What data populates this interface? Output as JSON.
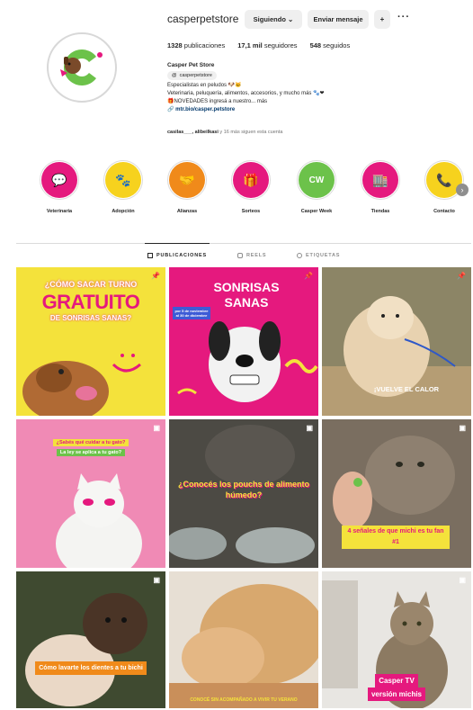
{
  "profile": {
    "username": "casperpetstore",
    "following_button": "Siguiendo",
    "following_chevron": "⌄",
    "message_button": "Enviar mensaje",
    "add_person_glyph": "+",
    "more_glyph": "···",
    "stats": {
      "posts_count": "1328",
      "posts_label": "publicaciones",
      "followers_count": "17,1 mil",
      "followers_label": "seguidores",
      "following_count": "548",
      "following_label": "seguidos"
    },
    "bio": {
      "name": "Casper Pet Store",
      "threads_handle": "casperpetstore",
      "line1": "Especialistas en peludos 🐶🐱",
      "line2": "Veterinaria, peluquería, alimentos, accesorios, y mucho más 🐾❤",
      "line3": "🎁NOVEDADES ingresá a nuestro... más",
      "link": "🔗 mtr.bio/casper.petstore"
    },
    "followed_by_users": "casilas___, alibeilkasi",
    "followed_by_rest": "y 16 más siguen esta cuenta"
  },
  "highlights": [
    {
      "label": "Veterinaria",
      "color": "#e5197e",
      "glyph": "💬"
    },
    {
      "label": "Adopción",
      "color": "#f6d21e",
      "glyph": "🐾"
    },
    {
      "label": "Alianzas",
      "color": "#f08a1a",
      "glyph": "🤝"
    },
    {
      "label": "Sorteos",
      "color": "#e5197e",
      "glyph": "🎁"
    },
    {
      "label": "Casper Week",
      "color": "#6cc24a",
      "glyph": "CW"
    },
    {
      "label": "Tiendas",
      "color": "#e5197e",
      "glyph": "🏬"
    },
    {
      "label": "Contacto",
      "color": "#f6d21e",
      "glyph": "📞"
    }
  ],
  "highlights_next_glyph": "›",
  "tabs": [
    {
      "label": "PUBLICACIONES",
      "active": true
    },
    {
      "label": "REELS",
      "active": false
    },
    {
      "label": "ETIQUETAS",
      "active": false
    }
  ],
  "posts": [
    {
      "caption_line1": "¿CÓMO SACAR TURNO",
      "caption_line2": "GRATUITO",
      "caption_line3": "DE SONRISAS SANAS?",
      "bg": "#f4e23b",
      "accent": "#e5197e",
      "pinned": true
    },
    {
      "caption_line1": "SONRISAS",
      "caption_line2": "SANAS",
      "caption_small": "por 5 de noviembre al 30 de diciembre",
      "bg": "#e5197e",
      "accent": "#3d5bd6",
      "pinned": true
    },
    {
      "caption": "¡VUELVE EL CALOR",
      "bg": "#7d6b52",
      "accent": "#f6d21e",
      "pinned": true
    },
    {
      "caption_line1": "¿Sabés qué cuidar a tu gato?",
      "caption_line2": "La ley se aplica a tu gato?",
      "bg": "#f08ab5",
      "accent": "#6cc24a",
      "pinned": false
    },
    {
      "caption": "¿Conocés los pouchs de alimento húmedo?",
      "bg": "#5e5a52",
      "accent": "#e5197e",
      "pinned": false
    },
    {
      "caption": "4 señales de que michi es tu fan #1",
      "bg": "#8a7a66",
      "accent": "#f6d21e",
      "pinned": false
    },
    {
      "caption": "Cómo lavarte los dientes a tu bichi",
      "bg": "#4e5b3c",
      "accent": "#f08a1a",
      "pinned": false
    },
    {
      "caption": "CONOCÉ SIN ACOMPAÑADO A VIVIR TU VERANO",
      "bg": "#d9b48c",
      "accent": "#f6d21e",
      "pinned": false
    },
    {
      "caption_line1": "Casper TV",
      "caption_line2": "versión michis",
      "bg": "#d7d4cf",
      "accent": "#e5197e",
      "pinned": false
    }
  ],
  "pin_glyph": "📌"
}
